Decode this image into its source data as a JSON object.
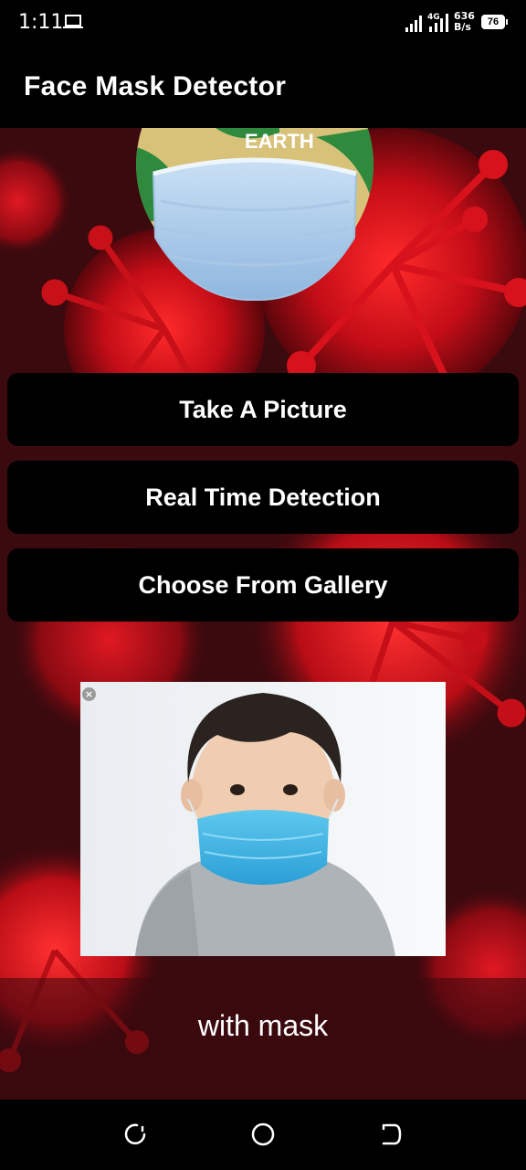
{
  "status_bar": {
    "time": "1:11",
    "network_type": "4G",
    "net_speed_value": "636",
    "net_speed_unit": "B/s",
    "battery": "76"
  },
  "app_bar": {
    "title": "Face Mask Detector"
  },
  "logo": {
    "text": "EARTH",
    "icon": "face-mask-logo"
  },
  "buttons": {
    "take_picture": "Take A Picture",
    "real_time": "Real Time Detection",
    "gallery": "Choose From Gallery"
  },
  "result": {
    "image_icon": "child-with-mask-photo",
    "close_glyph": "×",
    "label": "with mask"
  },
  "nav": {
    "recent_icon": "recent-apps-icon",
    "home_icon": "home-icon",
    "back_icon": "back-icon"
  },
  "colors": {
    "background": "#3a0a0e",
    "virus_red": "#d0101a",
    "button_bg": "#000000",
    "text": "#ffffff"
  }
}
